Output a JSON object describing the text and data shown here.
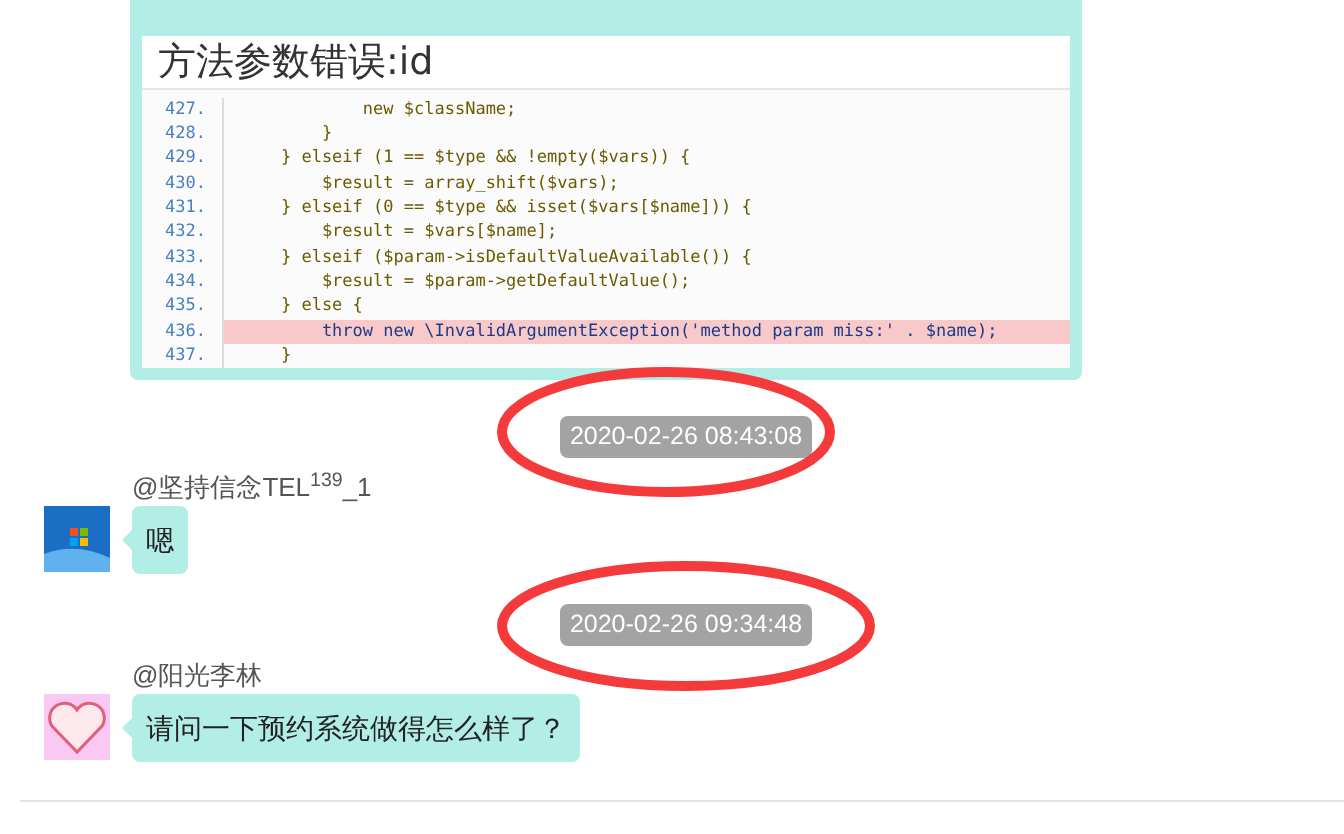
{
  "error_card": {
    "title": "方法参数错误:id",
    "code_lines": [
      {
        "number": "427.",
        "code": "            new $className;",
        "highlighted": false
      },
      {
        "number": "428.",
        "code": "        }",
        "highlighted": false
      },
      {
        "number": "429.",
        "code": "    } elseif (1 == $type && !empty($vars)) {",
        "highlighted": false
      },
      {
        "number": "430.",
        "code": "        $result = array_shift($vars);",
        "highlighted": false
      },
      {
        "number": "431.",
        "code": "    } elseif (0 == $type && isset($vars[$name])) {",
        "highlighted": false
      },
      {
        "number": "432.",
        "code": "        $result = $vars[$name];",
        "highlighted": false
      },
      {
        "number": "433.",
        "code": "    } elseif ($param->isDefaultValueAvailable()) {",
        "highlighted": false
      },
      {
        "number": "434.",
        "code": "        $result = $param->getDefaultValue();",
        "highlighted": false
      },
      {
        "number": "435.",
        "code": "    } else {",
        "highlighted": false
      },
      {
        "number": "436.",
        "code": "        throw new \\InvalidArgumentException('method param miss:' . $name);",
        "highlighted": true
      },
      {
        "number": "437.",
        "code": "    }",
        "highlighted": false
      }
    ]
  },
  "messages": [
    {
      "kind": "time",
      "text": "2020-02-26 08:43:08"
    },
    {
      "kind": "chat",
      "sender": "@坚持信念TEL$^{139}$_1",
      "text": "嗯"
    },
    {
      "kind": "time",
      "text": "2020-02-26 09:34:48"
    },
    {
      "kind": "chat",
      "sender": "@阳光李林",
      "text": "请问一下预约系统做得怎么样了？"
    }
  ]
}
